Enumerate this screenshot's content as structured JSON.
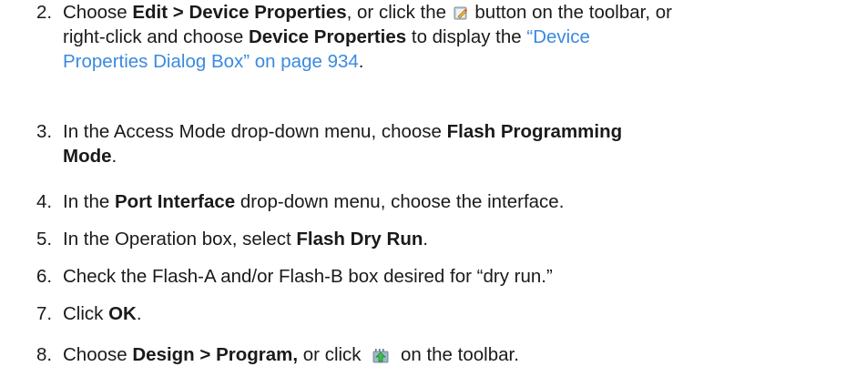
{
  "steps": [
    {
      "number": "2.",
      "line1": {
        "t1": "Choose ",
        "b1": "Edit > Device Properties",
        "t2": ", or click the ",
        "icon": "device-properties-icon",
        "t3": " button on the toolbar, or"
      },
      "line2": {
        "t1": "right-click and choose ",
        "b1": "Device Properties",
        "t2": " to display the ",
        "link_part1": "“Device"
      },
      "line3": {
        "link_part2": "Properties Dialog Box” on page 934",
        "t1": "."
      }
    },
    {
      "number": "3.",
      "line1": {
        "t1": "In the Access Mode drop-down menu, choose ",
        "b1": "Flash Programming"
      },
      "line2": {
        "b1": "Mode",
        "t1": "."
      }
    },
    {
      "number": "4.",
      "t1": "In the ",
      "b1": "Port Interface",
      "t2": " drop-down menu, choose the interface."
    },
    {
      "number": "5.",
      "t1": "In the Operation box, select ",
      "b1": "Flash Dry Run",
      "t2": "."
    },
    {
      "number": "6.",
      "t1": "Check the Flash-A and/or Flash-B box desired for “dry run.”"
    },
    {
      "number": "7.",
      "t1": "Click ",
      "b1": "OK",
      "t2": "."
    },
    {
      "number": "8.",
      "t1": "Choose ",
      "b1": "Design > Program,",
      "t2": " or click ",
      "icon": "program-icon",
      "t3": " on the toolbar."
    }
  ],
  "colors": {
    "text": "#1a1a1a",
    "link": "#3a8ae0"
  }
}
